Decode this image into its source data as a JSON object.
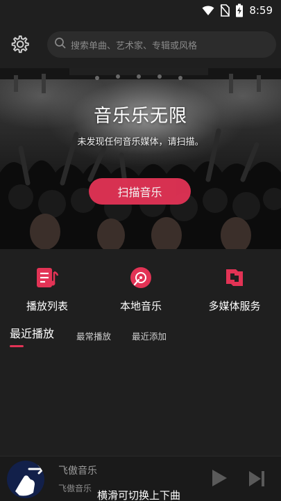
{
  "status_bar": {
    "time": "8:59"
  },
  "search": {
    "placeholder": "搜索单曲、艺术家、专辑或风格"
  },
  "banner": {
    "title": "音乐乐无限",
    "subtitle": "未发现任何音乐媒体，请扫描。",
    "scan_button_label": "扫描音乐"
  },
  "quick_actions": [
    {
      "label": "播放列表",
      "icon": "playlist-icon"
    },
    {
      "label": "本地音乐",
      "icon": "local-music-disc-icon"
    },
    {
      "label": "多媒体服务",
      "icon": "media-service-icon"
    }
  ],
  "tabs": [
    {
      "label": "最近播放",
      "active": true
    },
    {
      "label": "最常播放",
      "active": false
    },
    {
      "label": "最近添加",
      "active": false
    }
  ],
  "player": {
    "track_title": "飞傲音乐",
    "track_artist": "飞傲音乐",
    "swipe_hint": "横滑可切换上下曲"
  },
  "colors": {
    "accent": "#e23355",
    "background": "#1f1f1f",
    "search_bg": "#2c2c2c"
  }
}
